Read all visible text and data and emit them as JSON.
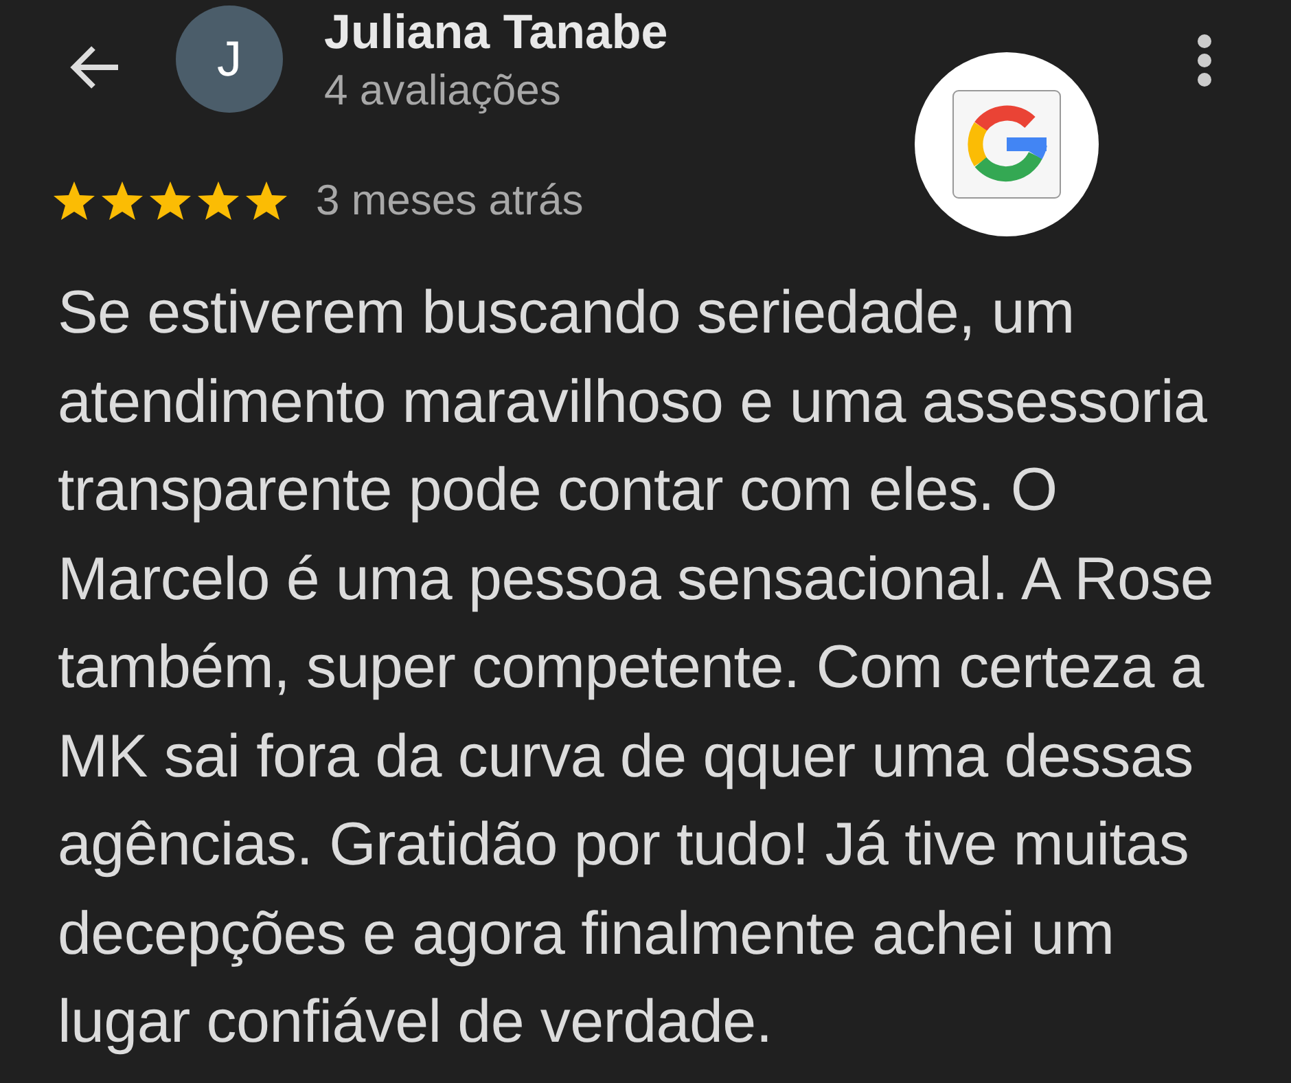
{
  "reviewer": {
    "name": "Juliana Tanabe",
    "initial": "J",
    "reviews": "4 avaliações"
  },
  "review": {
    "stars": 5,
    "time": "3 meses atrás",
    "text": "Se estiverem buscando seriedade, um atendimento maravilhoso e uma assessoria transparente pode contar com eles. O Marcelo é uma pessoa sensacional. A Rose também, super competente. Com certeza a MK sai fora da curva de qquer uma dessas agências. Gratidão por tudo! Já tive muitas decepções e agora finalmente achei um lugar confiável de verdade."
  }
}
